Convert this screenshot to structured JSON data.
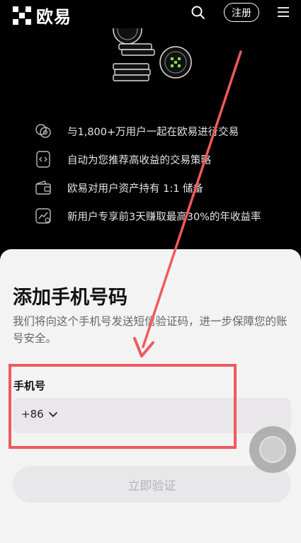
{
  "brand": {
    "name": "欧易"
  },
  "header": {
    "signup_label": "注册"
  },
  "features": [
    {
      "icon": "users-coin-icon",
      "text": "与1,800+万用户一起在欧易进行交易"
    },
    {
      "icon": "strategy-doc-icon",
      "text": "自动为您推荐高收益的交易策略"
    },
    {
      "icon": "wallet-icon",
      "text": "欧易对用户资产持有 1:1 储备"
    },
    {
      "icon": "chart-badge-icon",
      "text": "新用户专享前3天赚取最高30%的年收益率"
    }
  ],
  "sheet": {
    "title": "添加手机号码",
    "description": "我们将向这个手机号发送短信验证码，进一步保障您的账号安全。",
    "phone_label": "手机号",
    "country_code": "+86",
    "verify_label": "立即验证"
  },
  "colors": {
    "background": "#000000",
    "sheet": "#f3f3f3",
    "annotation_red": "#ee5a5f",
    "button_disabled": "#e8e7ea"
  }
}
